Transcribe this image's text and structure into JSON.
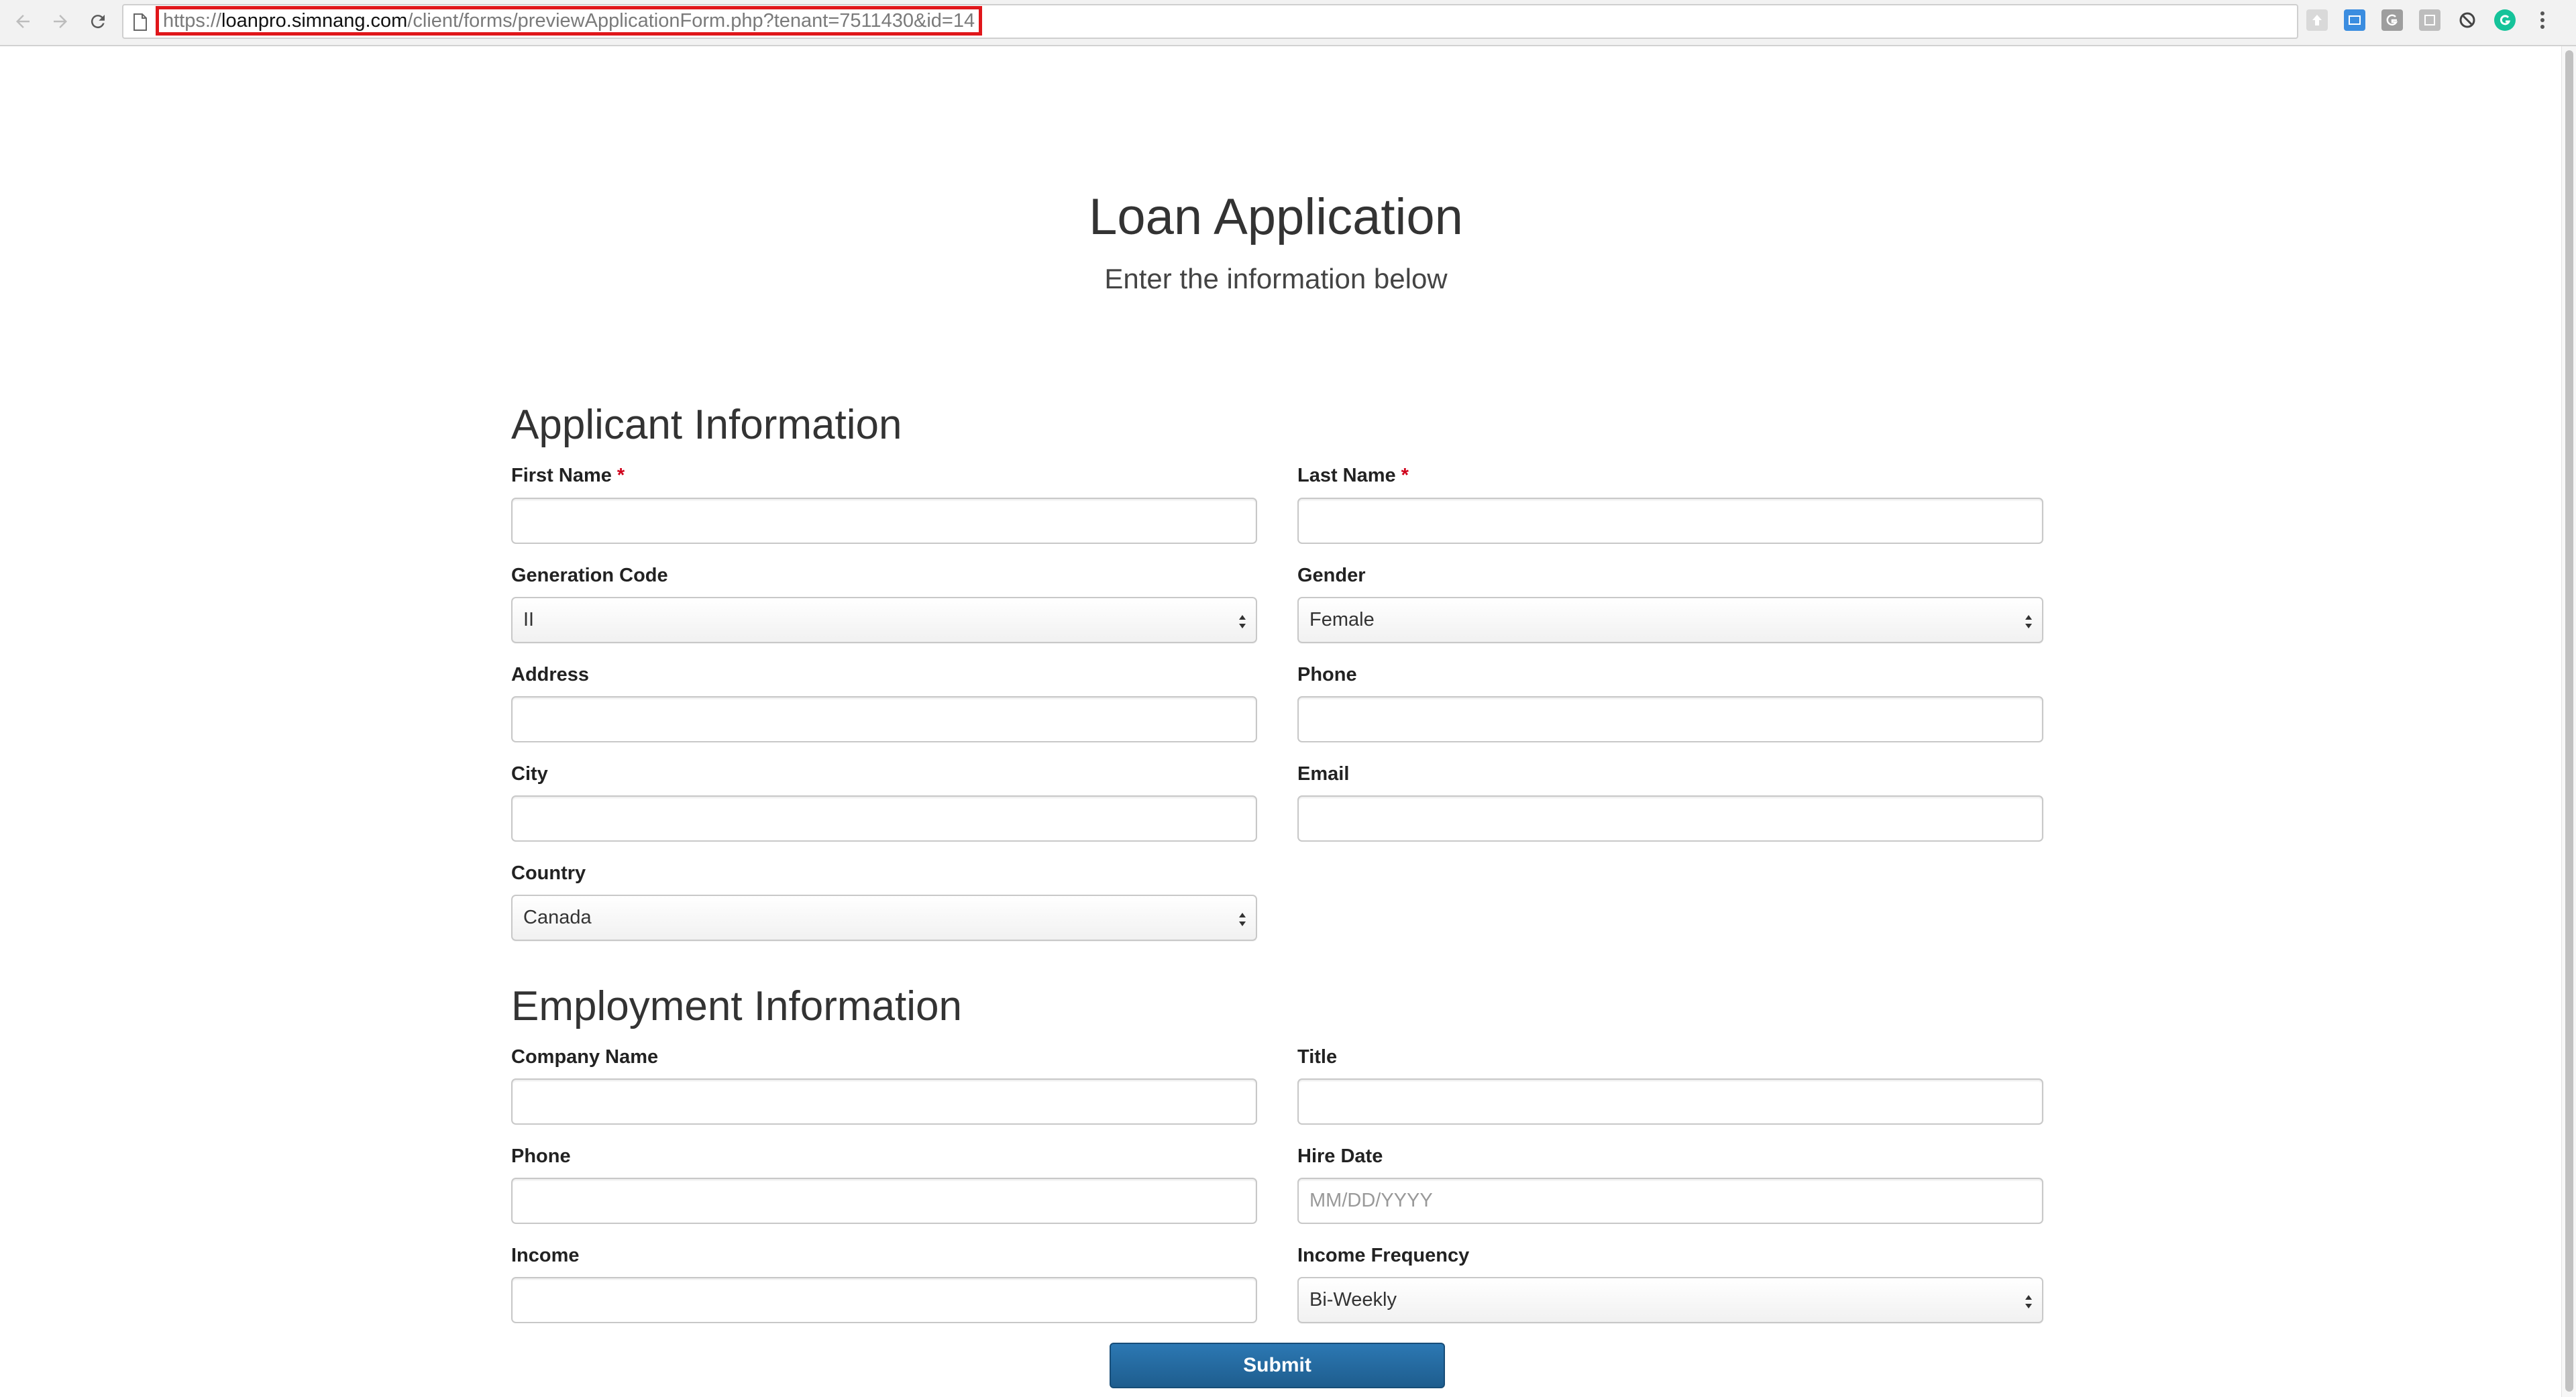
{
  "browser": {
    "url_host_prefix": "https://",
    "url_host": "loanpro.simnang.com",
    "url_path": "/client/forms/previewApplicationForm.php?tenant=7511430&id=14"
  },
  "page": {
    "title": "Loan Application",
    "subtitle": "Enter the information below"
  },
  "applicant": {
    "heading": "Applicant Information",
    "first_name_label": "First Name",
    "last_name_label": "Last Name",
    "required_mark": "*",
    "generation_code_label": "Generation Code",
    "generation_code_value": "II",
    "gender_label": "Gender",
    "gender_value": "Female",
    "address_label": "Address",
    "phone_label": "Phone",
    "city_label": "City",
    "email_label": "Email",
    "country_label": "Country",
    "country_value": "Canada"
  },
  "employment": {
    "heading": "Employment Information",
    "company_label": "Company Name",
    "title_label": "Title",
    "phone_label": "Phone",
    "hire_date_label": "Hire Date",
    "hire_date_placeholder": "MM/DD/YYYY",
    "income_label": "Income",
    "income_frequency_label": "Income Frequency",
    "income_frequency_value": "Bi-Weekly"
  },
  "submit_label": "Submit",
  "colors": {
    "url_highlight": "#e0161a",
    "required": "#d0021b",
    "submit_bg": "#2167a0"
  }
}
